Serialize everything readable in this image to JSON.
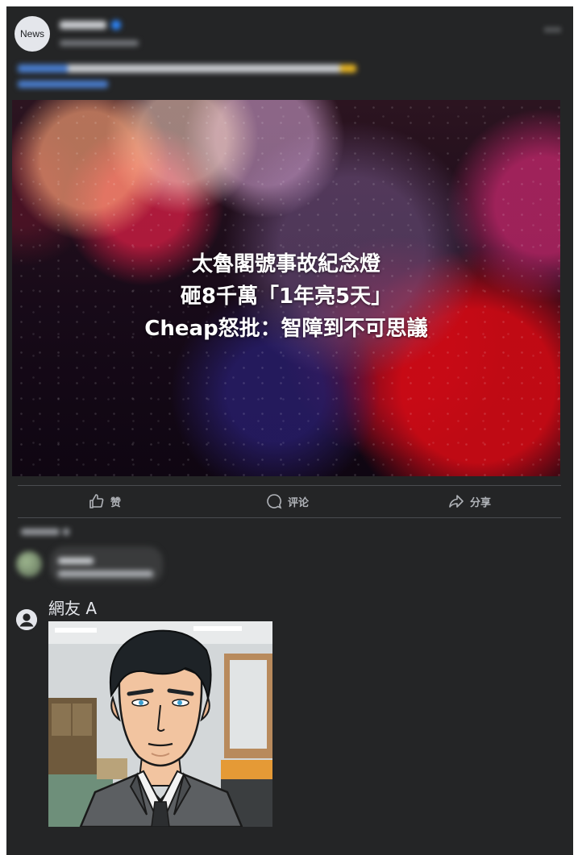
{
  "post": {
    "avatar_label": "News",
    "icons": {
      "verified": "verified-badge-icon",
      "globe": "globe-icon",
      "more": "more-dots-icon"
    }
  },
  "hero": {
    "headline_lines": [
      "太魯閣號事故紀念燈",
      "砸8千萬「1年亮5天」",
      "Cheap怒批：智障到不可思議"
    ]
  },
  "actions": {
    "like": {
      "label": "赞",
      "icon": "thumbs-up-icon"
    },
    "comment": {
      "label": "评论",
      "icon": "comment-bubble-icon"
    },
    "share": {
      "label": "分享",
      "icon": "share-arrow-icon"
    }
  },
  "comments": {
    "reply": {
      "name": "網友 A",
      "icon": "default-user-icon",
      "image_icon": "cartoon-agent-portrait"
    }
  },
  "colors": {
    "card_bg": "#242526",
    "text_primary": "#e4e6eb",
    "text_secondary": "#b0b3b8",
    "divider": "#4a4c50",
    "link_blue": "#4a7fd1"
  }
}
